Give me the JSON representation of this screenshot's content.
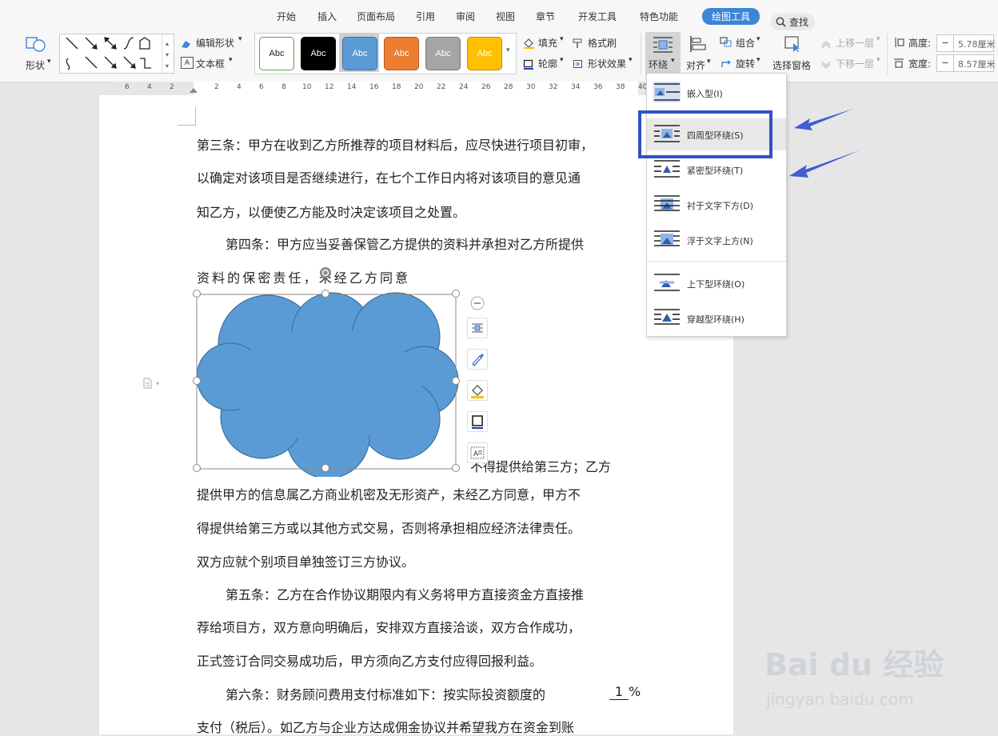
{
  "tabs": [
    "开始",
    "插入",
    "页面布局",
    "引用",
    "审阅",
    "视图",
    "章节",
    "开发工具",
    "特色功能"
  ],
  "active_tab": "绘图工具",
  "search_label": "查找",
  "shapes": {
    "shape_label": "形状",
    "edit_shape": "编辑形状",
    "textbox": "文本框"
  },
  "styles": [
    {
      "label": "Abc",
      "bg": "#ffffff",
      "fg": "#222222",
      "border": "#5aa04a"
    },
    {
      "label": "Abc",
      "bg": "#000000",
      "fg": "#ffffff",
      "border": "#000000"
    },
    {
      "label": "Abc",
      "bg": "#5b9bd5",
      "fg": "#ffffff",
      "border": "#41719c"
    },
    {
      "label": "Abc",
      "bg": "#ed7d31",
      "fg": "#ffffff",
      "border": "#ae5a21"
    },
    {
      "label": "Abc",
      "bg": "#a5a5a5",
      "fg": "#ffffff",
      "border": "#787878"
    },
    {
      "label": "Abc",
      "bg": "#ffc000",
      "fg": "#ffffff",
      "border": "#bc8c00"
    }
  ],
  "format": {
    "fill": "填充",
    "format_brush": "格式刷",
    "outline": "轮廓",
    "shape_effect": "形状效果"
  },
  "arrange": {
    "wrap": "环绕",
    "align": "对齐",
    "group": "组合",
    "rotate": "旋转",
    "selection_pane": "选择窗格",
    "bring_forward": "上移一层",
    "send_backward": "下移一层"
  },
  "size": {
    "height_label": "高度:",
    "height_value": "5.78厘米",
    "width_label": "宽度:",
    "width_value": "8.57厘米"
  },
  "ruler_numbers": [
    "6",
    "4",
    "2",
    "2",
    "4",
    "6",
    "8",
    "10",
    "12",
    "14",
    "16",
    "18",
    "20",
    "22",
    "24",
    "26",
    "28",
    "30",
    "32",
    "34",
    "36",
    "38",
    "40"
  ],
  "wrap_menu": [
    "嵌入型(I)",
    "四周型环绕(S)",
    "紧密型环绕(T)",
    "衬于文字下方(D)",
    "浮于文字上方(N)",
    "上下型环绕(O)",
    "穿越型环绕(H)"
  ],
  "document": {
    "lines": [
      "第三条：甲方在收到乙方所推荐的项目材料后，应尽快进行项目初审，",
      "以确定对该项目是否继续进行，在七个工作日内将对该项目的意见通",
      "知乙方，以便使乙方能及时决定该项目之处置。",
      "第四条：甲方应当妥善保管乙方提供的资料并承担对乙方所提供",
      "资  料  的  保  密  责  任  ，  未  经  乙  方  同  意",
      "不得提供给第三方；乙方",
      "提供甲方的信息属乙方商业机密及无形资产，未经乙方同意，甲方不",
      "得提供给第三方或以其他方式交易，否则将承担相应经济法律责任。",
      "双方应就个别项目单独签订三方协议。",
      "第五条：乙方在合作协议期限内有义务将甲方直接资金方直接推",
      "荐给项目方，双方意向明确后，安排双方直接洽谈，双方合作成功，",
      "正式签订合同交易成功后，甲方须向乙方支付应得回报利益。",
      "第六条：财务顾问费用支付标准如下：按实际投资额度的",
      "1",
      "%",
      "支付（税后）。如乙方与企业方达成佣金协议并希望我方在资金到账"
    ]
  },
  "watermark": {
    "logo": "Bai du 经验",
    "url": "jingyan.baidu.com"
  },
  "colors": {
    "accent": "#3b86d7",
    "shape_fill": "#5b9bd5",
    "shape_stroke": "#41719c",
    "highlight_box": "#2f52c8",
    "arrow": "#3e5fd1"
  }
}
